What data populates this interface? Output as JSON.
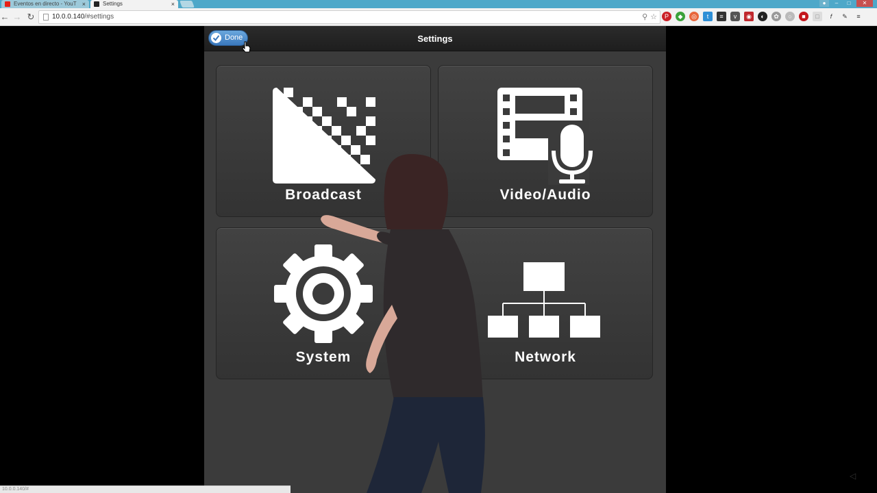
{
  "browser": {
    "tabs": [
      {
        "title": "Eventos en directo - YouT",
        "active": false
      },
      {
        "title": "Settings",
        "active": true
      }
    ],
    "tab_close": "×",
    "url_host": "10.0.0.140",
    "url_path": "/#settings",
    "status_url": "10.0.0.140/#"
  },
  "header": {
    "done_label": "Done",
    "title": "Settings"
  },
  "tiles": [
    {
      "id": "broadcast",
      "label": "Broadcast"
    },
    {
      "id": "videoaudio",
      "label": "Video/Audio"
    },
    {
      "id": "system",
      "label": "System"
    },
    {
      "id": "network",
      "label": "Network"
    }
  ],
  "colors": {
    "tab_strip": "#4ea8c9",
    "app_background": "#3b3b3b",
    "done_button": "#3a78bd",
    "tile_background": "#3a3a3a",
    "icon_white": "#ffffff"
  }
}
